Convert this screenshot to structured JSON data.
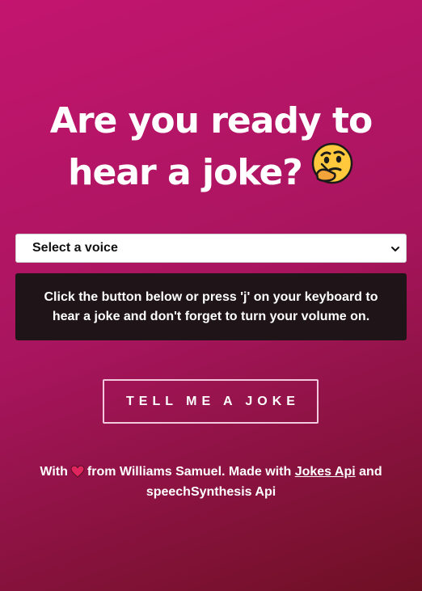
{
  "header": {
    "title_line1": "Are you ready to",
    "title_line2": "hear a joke?",
    "emoji_icon": "thinking-face-icon"
  },
  "voice_select": {
    "selected": "Select a voice",
    "icon": "chevron-down-icon"
  },
  "info": {
    "text": "Click the button below or press 'j' on your keyboard to hear a joke and don't forget to turn your volume on."
  },
  "action": {
    "button_label": "TELL ME A JOKE"
  },
  "footer": {
    "prefix": "With",
    "heart_icon": "heart-icon",
    "middle": "from Williams Samuel. Made with",
    "link1": "Jokes Api",
    "and_text": "and",
    "link2": "speechSynthesis Api"
  },
  "colors": {
    "background_start": "#c3156f",
    "background_end": "#6e1024",
    "info_box": "#1f1417",
    "heart": "#e0245e"
  }
}
